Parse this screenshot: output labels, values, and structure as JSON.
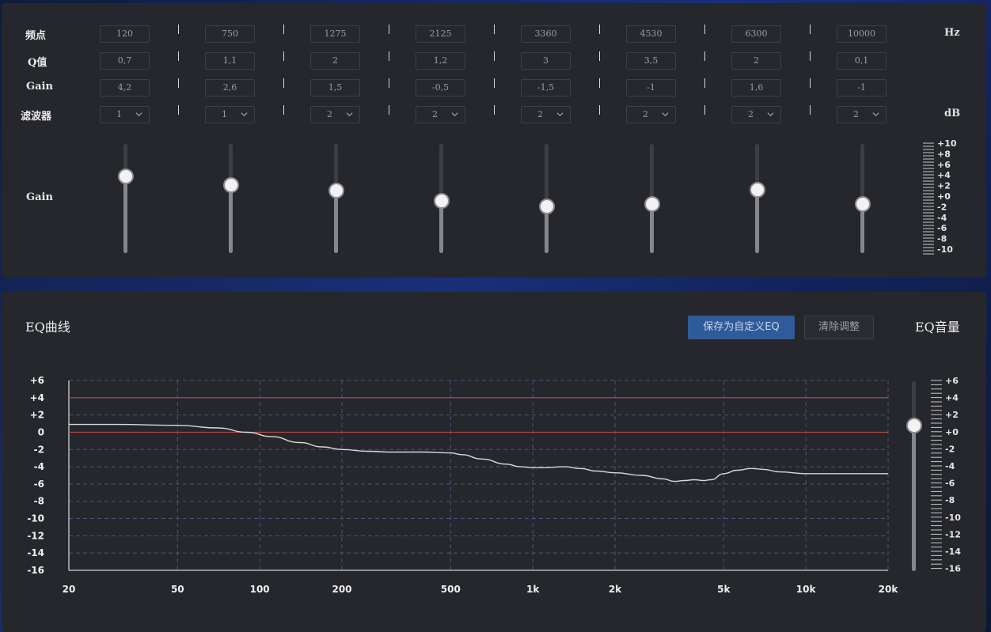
{
  "eq": {
    "row_labels": {
      "freq": "频点",
      "q": "Q值",
      "gain": "Gain",
      "filter": "滤波器",
      "slider_gain": "Gain"
    },
    "units": {
      "hz": "Hz",
      "db": "dB"
    },
    "bands": [
      {
        "freq": "120",
        "q": "0,7",
        "gain": "4,2",
        "filter": "1",
        "level": 4.2
      },
      {
        "freq": "750",
        "q": "1,1",
        "gain": "2,6",
        "filter": "1",
        "level": 2.6
      },
      {
        "freq": "1275",
        "q": "2",
        "gain": "1,5",
        "filter": "2",
        "level": 1.5
      },
      {
        "freq": "2125",
        "q": "1,2",
        "gain": "-0,5",
        "filter": "2",
        "level": -0.5
      },
      {
        "freq": "3360",
        "q": "3",
        "gain": "-1,5",
        "filter": "2",
        "level": -1.5
      },
      {
        "freq": "4530",
        "q": "3,5",
        "gain": "-1",
        "filter": "2",
        "level": -1
      },
      {
        "freq": "6300",
        "q": "2",
        "gain": "1,6",
        "filter": "2",
        "level": 1.6
      },
      {
        "freq": "10000",
        "q": "0,1",
        "gain": "-1",
        "filter": "2",
        "level": -1
      }
    ],
    "scale_labels": [
      "+10",
      "+8",
      "+6",
      "+4",
      "+2",
      "+0",
      "-2",
      "-4",
      "-6",
      "-8",
      "-10"
    ]
  },
  "curve": {
    "title": "EQ曲线",
    "save_label": "保存为自定义EQ",
    "clear_label": "清除调整",
    "volume_title": "EQ音量",
    "volume_level": 1.0,
    "volume_scale_labels": [
      "+6",
      "+4",
      "+2",
      "+0",
      "-2",
      "-4",
      "-6",
      "-8",
      "-10",
      "-12",
      "-14",
      "-16"
    ],
    "colors": {
      "curve": "#d8d8d8",
      "reference": "#b5484a",
      "grid": "#4c5577",
      "accent": "#2f5b9a"
    }
  },
  "chart_data": {
    "type": "line",
    "title": "EQ曲线",
    "x_scale": "log",
    "xlim": [
      20,
      20000
    ],
    "ylim": [
      -16,
      6
    ],
    "y_ticks": [
      6,
      4,
      2,
      0,
      -2,
      -4,
      -6,
      -8,
      -10,
      -12,
      -14,
      -16
    ],
    "y_tick_labels": [
      "+6",
      "+4",
      "+2",
      "0",
      "-2",
      "-4",
      "-6",
      "-8",
      "-10",
      "-12",
      "-14",
      "-16"
    ],
    "x_ticks": [
      20,
      50,
      100,
      200,
      500,
      1000,
      2000,
      5000,
      10000,
      20000
    ],
    "x_tick_labels": [
      "20",
      "50",
      "100",
      "200",
      "500",
      "1k",
      "2k",
      "5k",
      "10k",
      "20k"
    ],
    "grid": true,
    "reference_lines": [
      4,
      0
    ],
    "series": [
      {
        "x": [
          20,
          30,
          50,
          70,
          90,
          110,
          140,
          170,
          200,
          250,
          300,
          400,
          500,
          550,
          650,
          800,
          900,
          1000,
          1100,
          1300,
          1500,
          1700,
          2000,
          2500,
          3000,
          3300,
          3600,
          3900,
          4200,
          4500,
          5000,
          5600,
          6300,
          7000,
          8000,
          10000,
          13000,
          20000
        ],
        "y": [
          0.9,
          0.9,
          0.8,
          0.5,
          0.0,
          -0.5,
          -1.2,
          -1.7,
          -2.0,
          -2.2,
          -2.3,
          -2.3,
          -2.4,
          -2.6,
          -3.1,
          -3.7,
          -4.0,
          -4.1,
          -4.1,
          -4.0,
          -4.2,
          -4.5,
          -4.7,
          -5.0,
          -5.4,
          -5.7,
          -5.6,
          -5.5,
          -5.6,
          -5.5,
          -4.8,
          -4.4,
          -4.2,
          -4.3,
          -4.6,
          -4.8,
          -4.8,
          -4.8
        ]
      }
    ]
  }
}
